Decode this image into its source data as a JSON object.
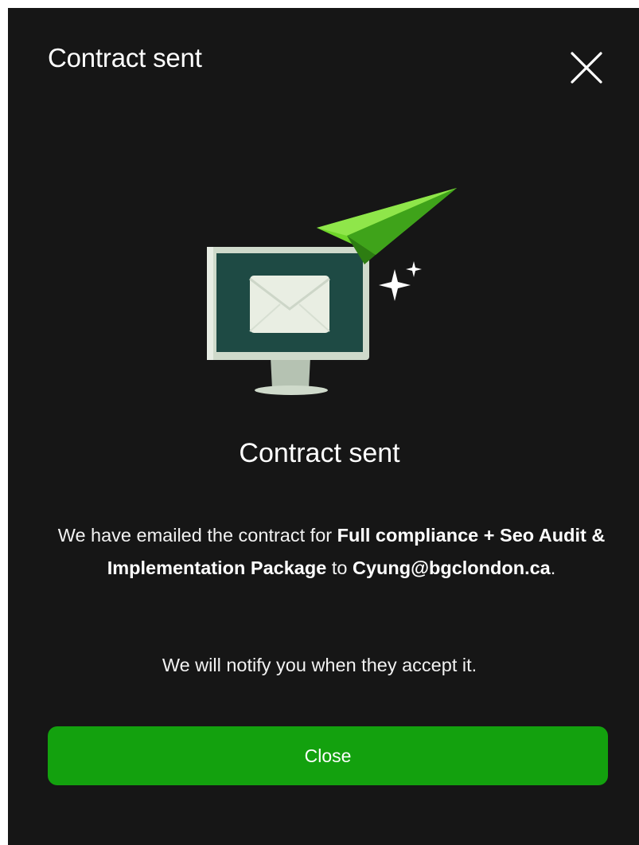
{
  "modal": {
    "header_title": "Contract sent",
    "body_title": "Contract sent",
    "message": {
      "prefix": "We have emailed the contract for ",
      "package": "Full compliance + Seo Audit & Implementation Package",
      "middle": " to ",
      "email": "Cyung@bgclondon.ca",
      "suffix": "."
    },
    "notify_text": "We will notify you when they accept it.",
    "close_button_label": "Close"
  },
  "icons": {
    "close": "close-icon",
    "illustration": "computer-email-paper-plane-icon"
  },
  "colors": {
    "background": "#161616",
    "accent_green": "#13a10e",
    "monitor_screen": "#1e4a44",
    "monitor_frame": "#cfdacb",
    "plane_green": "#6fd62a"
  }
}
